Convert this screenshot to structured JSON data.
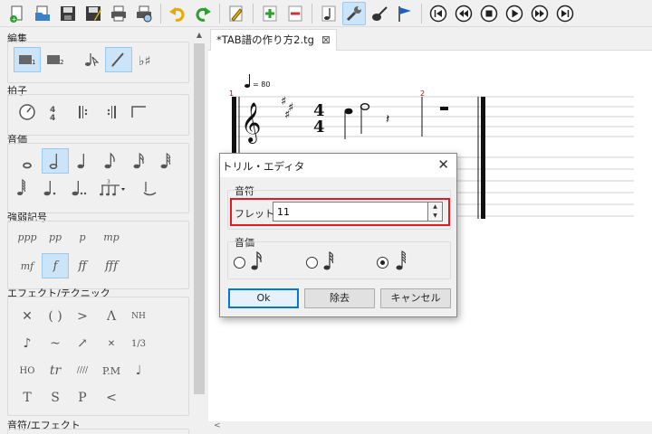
{
  "panel": {
    "edit_title": "編集",
    "time_title": "拍子",
    "duration_title": "音価",
    "dynamics_title": "強弱記号",
    "effects_title": "エフェクト/テクニック",
    "note_effects_title": "音符/エフェクト",
    "dynamics": [
      "ppp",
      "pp",
      "p",
      "mp",
      "mf",
      "f",
      "ff",
      "fff"
    ],
    "effects": [
      "✕",
      "( )",
      ">",
      "Λ",
      "NH",
      "♪",
      "~",
      "↗",
      "✕",
      "1/3",
      "HO",
      "tr",
      "////",
      "P.M",
      "♩",
      "T",
      "S",
      "P",
      "<"
    ]
  },
  "tab": {
    "title": "*TAB譜の作り方2.tg",
    "close": "⊠"
  },
  "score": {
    "tempo": "= 80",
    "measure1": "1",
    "measure2": "2"
  },
  "dialog": {
    "title": "トリル・エディタ",
    "close": "✕",
    "note_group": "音符",
    "fret_label": "フレット:",
    "fret_value": "11",
    "duration_group": "音価",
    "duration_selected": 2,
    "ok": "Ok",
    "remove": "除去",
    "cancel": "キャンセル"
  },
  "colors": {
    "highlight": "#e21b23",
    "selection": "#cce4f7"
  }
}
